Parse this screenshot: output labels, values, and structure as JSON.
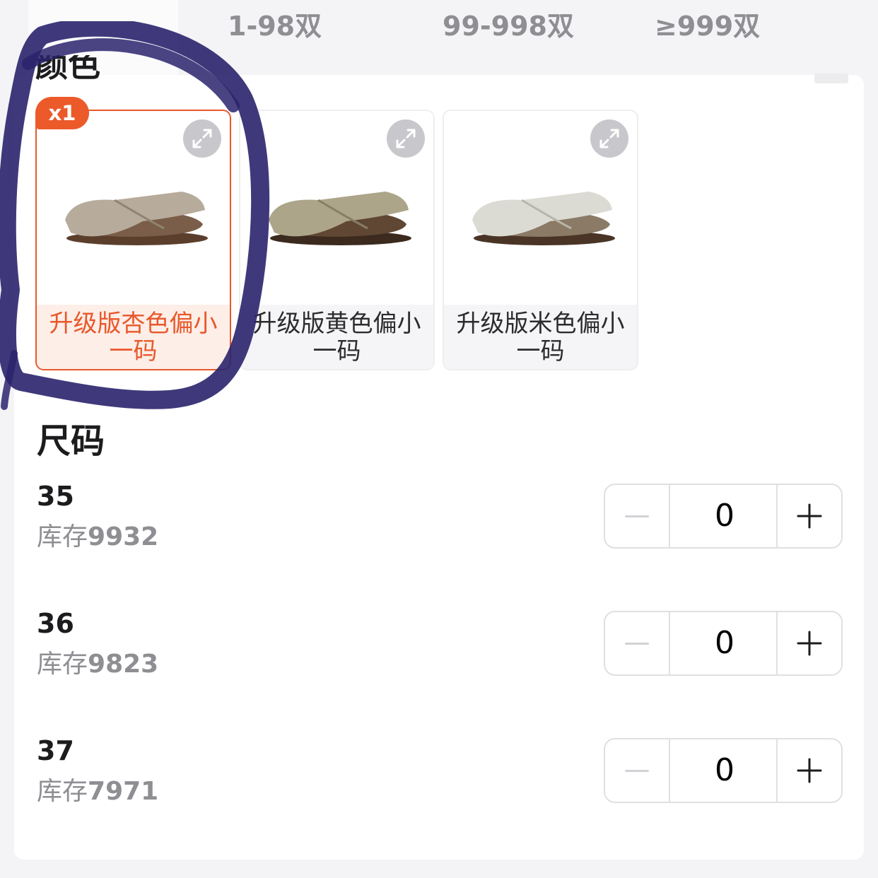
{
  "price_tiers": [
    {
      "label": "1-98双"
    },
    {
      "label": "99-998双"
    },
    {
      "label": "≥999双"
    }
  ],
  "color_section": {
    "title": "颜色",
    "selected_count_badge": "x1",
    "options": [
      {
        "name": "升级版杏色偏小一码",
        "selected": true,
        "shoe_color": "#b7ab9b",
        "icon": "expand-icon"
      },
      {
        "name": "升级版黄色偏小一码",
        "selected": false,
        "shoe_color": "#ada58a",
        "icon": "expand-icon"
      },
      {
        "name": "升级版米色偏小一码",
        "selected": false,
        "shoe_color": "#dcdbd3",
        "icon": "expand-icon"
      }
    ]
  },
  "size_section": {
    "title": "尺码",
    "rows": [
      {
        "size": "35",
        "stock_label": "库存",
        "stock": "9932",
        "quantity": "0"
      },
      {
        "size": "36",
        "stock_label": "库存",
        "stock": "9823",
        "quantity": "0"
      },
      {
        "size": "37",
        "stock_label": "库存",
        "stock": "7971",
        "quantity": "0"
      }
    ]
  },
  "colors": {
    "accent": "#e8582c",
    "badge": "#ec5a2a",
    "annotation_ink": "#2a236d"
  }
}
